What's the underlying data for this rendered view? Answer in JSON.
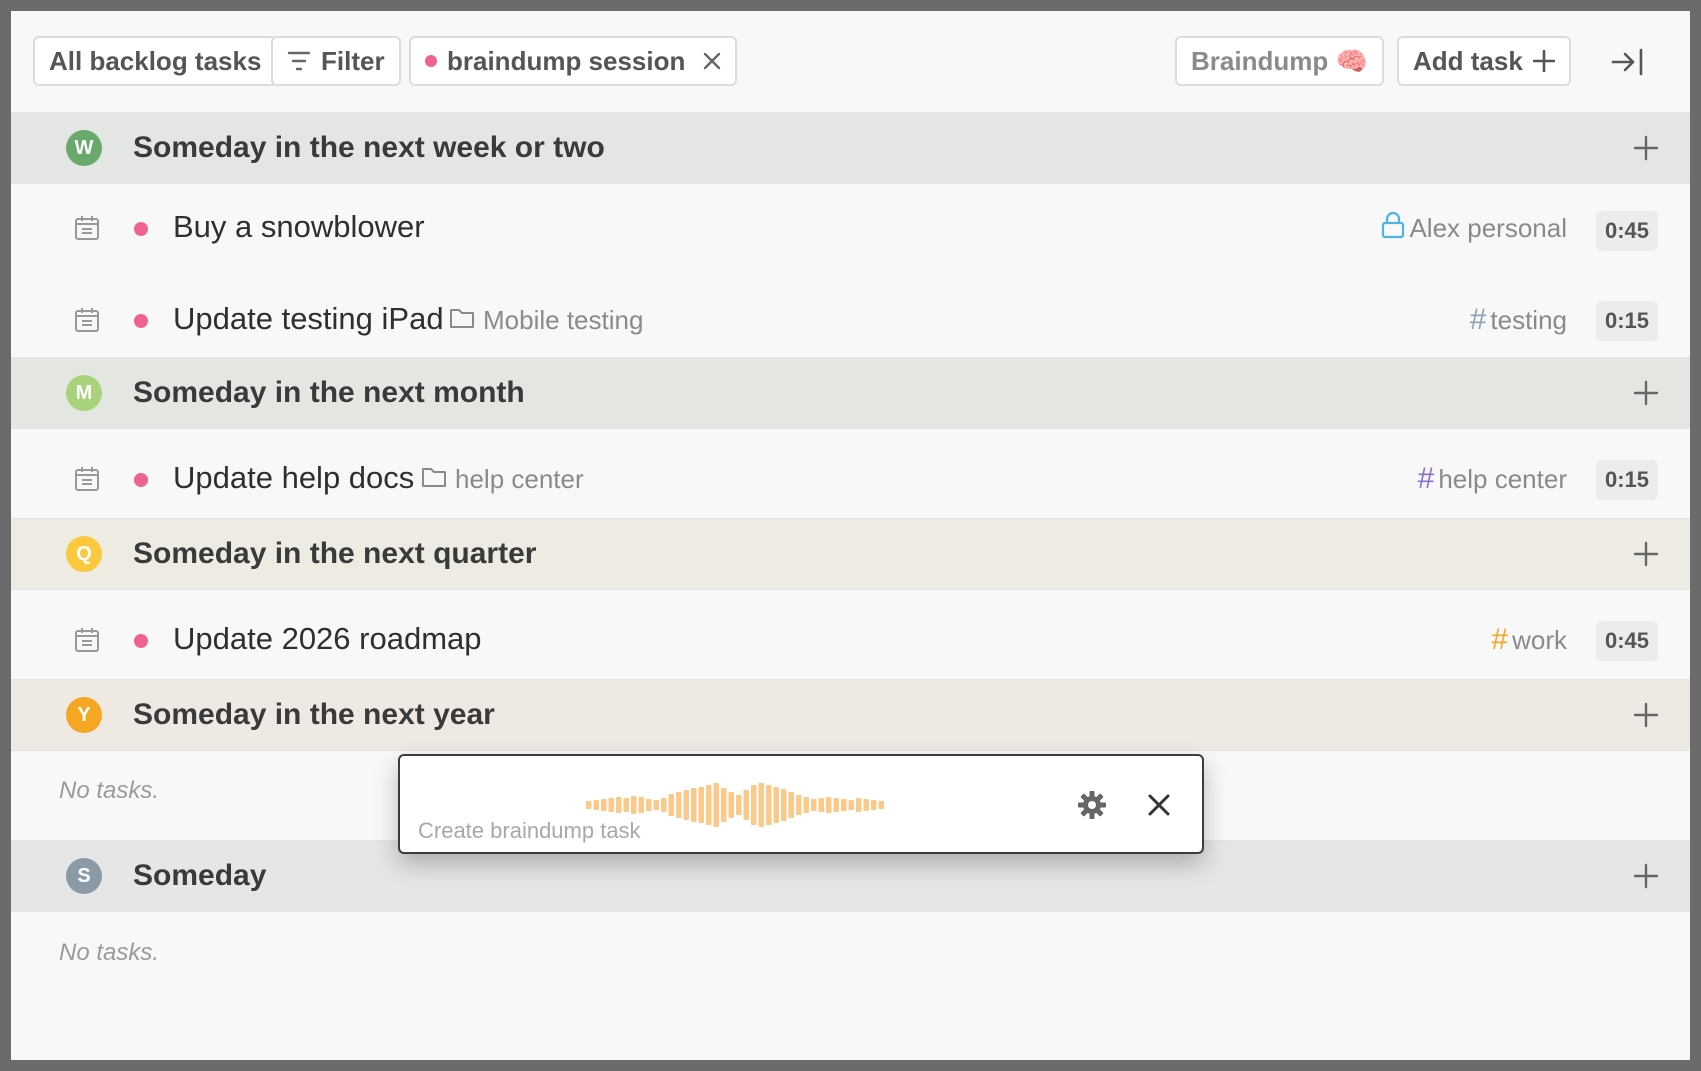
{
  "toolbar": {
    "all_tasks": "All backlog tasks",
    "filter": "Filter",
    "session_chip": "braindump session",
    "braindump": "Braindump 🧠",
    "add_task": "Add task"
  },
  "sections": [
    {
      "badge": "W",
      "badge_color": "#6aa96c",
      "title": "Someday in the next week or two",
      "bg": "#e3e6e2",
      "tasks": [
        {
          "title": "Buy a snowblower",
          "tag": "Alex personal",
          "tag_icon": "lock-icon",
          "tag_color": "#4fb3e8",
          "duration": "0:45"
        },
        {
          "title": "Update testing iPad",
          "project": "Mobile testing",
          "tag": "testing",
          "tag_icon": "hash-icon",
          "tag_color": "#8fa3b3",
          "duration": "0:15"
        }
      ]
    },
    {
      "badge": "M",
      "badge_color": "#a8d37b",
      "title": "Someday in the next month",
      "bg": "#e4e7e1",
      "tasks": [
        {
          "title": "Update help docs",
          "project": "help center",
          "tag": "help center",
          "tag_icon": "hash-icon",
          "tag_color": "#8a6fd1",
          "duration": "0:15"
        }
      ]
    },
    {
      "badge": "Q",
      "badge_color": "#fbc93d",
      "title": "Someday in the next quarter",
      "bg": "#eeebe3",
      "tasks": [
        {
          "title": "Update 2026 roadmap",
          "tag": "work",
          "tag_icon": "hash-icon",
          "tag_color": "#f5a623",
          "duration": "0:45"
        }
      ]
    },
    {
      "badge": "Y",
      "badge_color": "#f5a623",
      "title": "Someday in the next year",
      "bg": "#efe9e3",
      "empty_text": "No tasks."
    },
    {
      "badge": "S",
      "badge_color": "#8a9aa6",
      "title": "Someday",
      "bg": "#e6e6e6",
      "empty_text": "No tasks."
    }
  ],
  "popup": {
    "label": "Create braindump task",
    "wave_color": "#fbc98a"
  }
}
